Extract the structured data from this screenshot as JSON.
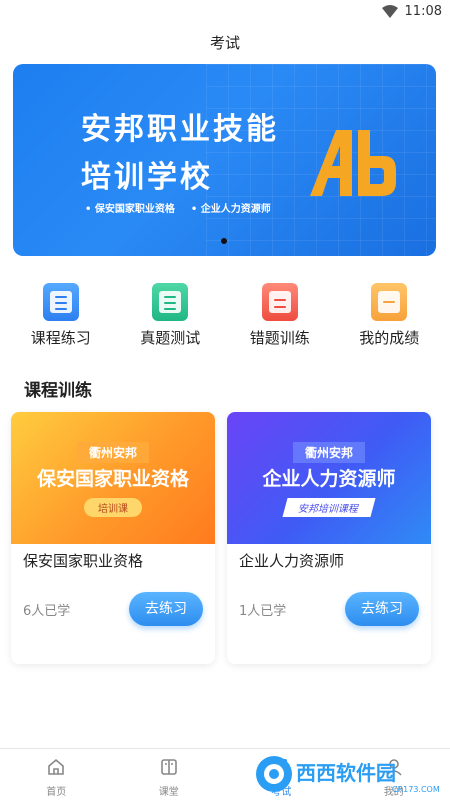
{
  "status_bar": {
    "time": "11:08"
  },
  "header": {
    "title": "考试"
  },
  "banner": {
    "title_line1": "安邦职业技能",
    "title_line2": "培训学校",
    "tags": [
      "保安国家职业资格",
      "企业人力资源师"
    ]
  },
  "quick_links": [
    {
      "label": "课程练习",
      "icon": "course-practice-icon"
    },
    {
      "label": "真题测试",
      "icon": "exam-test-icon"
    },
    {
      "label": "错题训练",
      "icon": "wrong-question-icon"
    },
    {
      "label": "我的成绩",
      "icon": "score-icon"
    }
  ],
  "section": {
    "title": "课程训练"
  },
  "courses": [
    {
      "thumb_sub": "衢州安邦",
      "thumb_main": "保安国家职业资格",
      "thumb_pill": "培训课",
      "name": "保安国家职业资格",
      "learners": "6人已学",
      "button": "去练习"
    },
    {
      "thumb_sub": "衢州安邦",
      "thumb_main": "企业人力资源师",
      "thumb_pill": "安邦培训课程",
      "name": "企业人力资源师",
      "learners": "1人已学",
      "button": "去练习"
    }
  ],
  "tab_bar": {
    "tabs": [
      {
        "label": "首页",
        "icon": "home-icon"
      },
      {
        "label": "课堂",
        "icon": "book-icon"
      },
      {
        "label": "考试",
        "icon": "exam-icon"
      },
      {
        "label": "我的",
        "icon": "profile-icon"
      }
    ]
  },
  "watermark": {
    "text": "西西软件园",
    "sub": "CR173.COM"
  },
  "colors": {
    "accent": "#2e8ef0",
    "banner": "#1d7ef0",
    "logo_orange": "#f5a623"
  }
}
